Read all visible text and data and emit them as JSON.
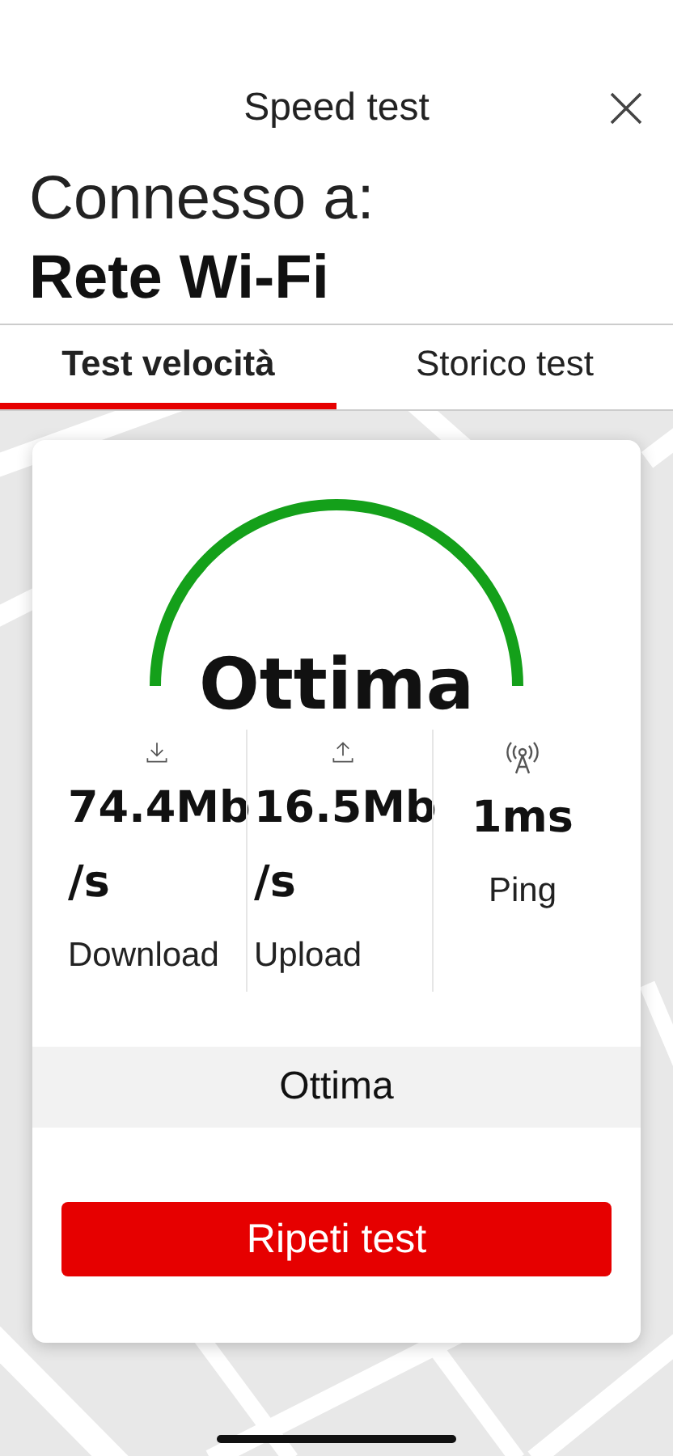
{
  "header": {
    "title": "Speed test"
  },
  "connection": {
    "label": "Connesso a:",
    "network": "Rete Wi-Fi"
  },
  "tabs": [
    {
      "label": "Test velocità",
      "selected": true
    },
    {
      "label": "Storico test",
      "selected": false
    }
  ],
  "result": {
    "rating": "Ottima",
    "metrics": [
      {
        "kind": "download",
        "value": "74.4Mb /s",
        "label": "Download"
      },
      {
        "kind": "upload",
        "value": "16.5Mb /s",
        "label": "Upload"
      },
      {
        "kind": "ping",
        "value": "1ms",
        "label": "Ping"
      }
    ],
    "summary": "Ottima",
    "button": "Ripeti test"
  }
}
